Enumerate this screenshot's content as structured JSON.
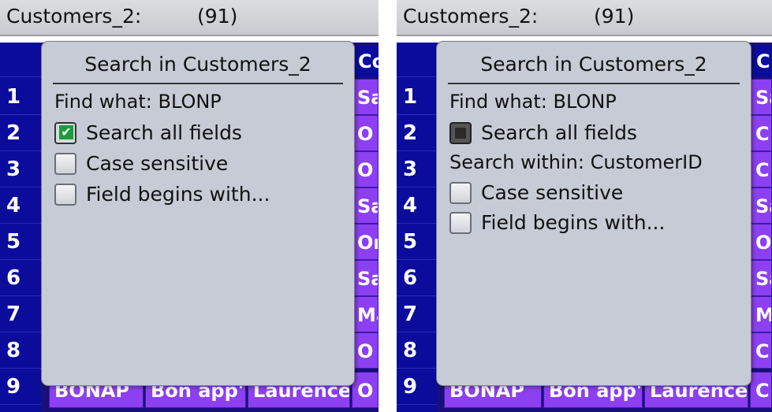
{
  "left": {
    "window": {
      "title": "Customers_2:",
      "count": "(91)"
    },
    "grid": {
      "col_header_right": "Co",
      "row_numbers": [
        "1",
        "2",
        "3",
        "4",
        "5",
        "6",
        "7",
        "8",
        "9"
      ],
      "right_cells": [
        "Sa",
        "O",
        "O",
        "Sa",
        "Or",
        "Sa",
        "Ma",
        "O",
        "O"
      ],
      "bottom_row": [
        "BONAP",
        "Bon app'",
        "Laurence",
        "O"
      ]
    },
    "dialog": {
      "title": "Search in Customers_2",
      "find_what": "Find what: BLONP",
      "options": [
        {
          "label": "Search all fields",
          "state": "checked"
        },
        {
          "label": "Case sensitive",
          "state": "unchecked"
        },
        {
          "label": "Field begins with...",
          "state": "unchecked"
        }
      ]
    }
  },
  "right": {
    "window": {
      "title": "Customers_2:",
      "count": "(91)"
    },
    "grid": {
      "col_header_right": "C",
      "row_numbers": [
        "1",
        "2",
        "3",
        "4",
        "5",
        "6",
        "7",
        "8",
        "9"
      ],
      "right_cells": [
        "Sa",
        "C",
        "C",
        "Sa",
        "O",
        "Sa",
        "Ma",
        "C",
        "C"
      ],
      "bottom_row": [
        "BONAP",
        "Bon app'",
        "Laurence",
        "C"
      ]
    },
    "dialog": {
      "title": "Search in Customers_2",
      "find_what": "Find what: BLONP",
      "search_all": {
        "label": "Search all fields",
        "state": "disabled"
      },
      "search_within": "Search within: CustomerID",
      "options": [
        {
          "label": "Case sensitive",
          "state": "unchecked"
        },
        {
          "label": "Field begins with...",
          "state": "unchecked"
        }
      ]
    }
  },
  "colors": {
    "row_number_bg": "#0c0c9c",
    "cell_bg": "#8d3ff2",
    "dialog_bg": "#c6cbd5",
    "checkmark": "#1c9c3c"
  }
}
